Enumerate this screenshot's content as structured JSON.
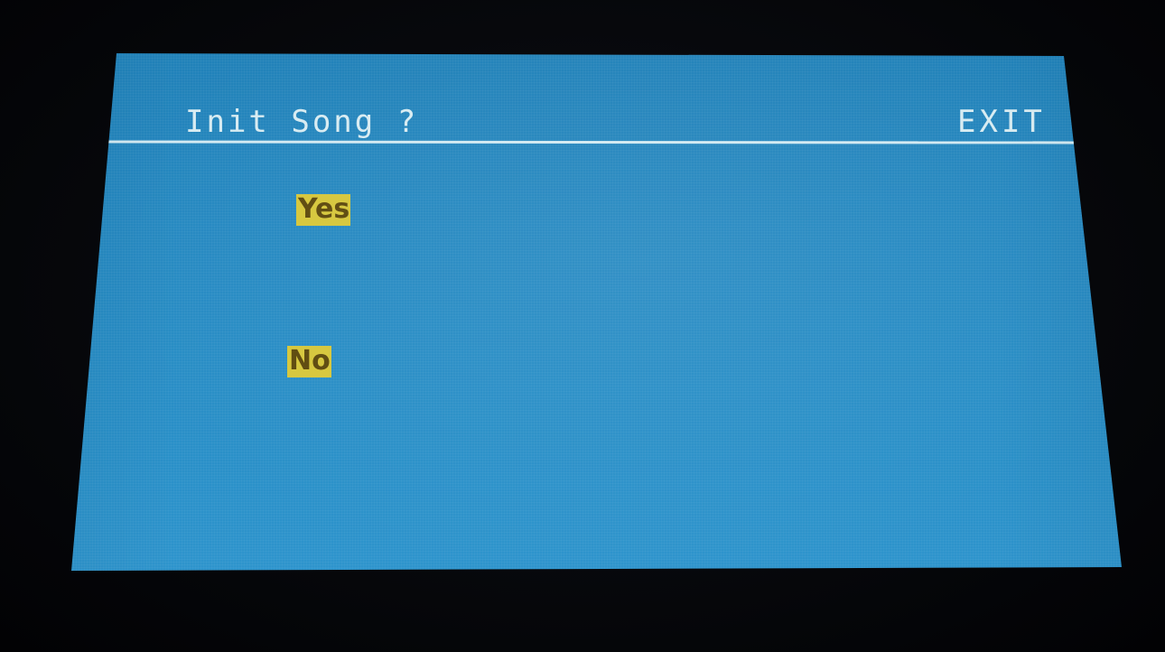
{
  "dialog": {
    "title": "Init Song ?",
    "exit_label": "EXIT"
  },
  "options": [
    {
      "label": "Yes"
    },
    {
      "label": "No"
    }
  ],
  "colors": {
    "screen_background": "#2689c1",
    "text": "#d8ecf2",
    "option_highlight": "#d6c73c",
    "option_text": "#5e4a0e",
    "bezel": "#07080c"
  }
}
